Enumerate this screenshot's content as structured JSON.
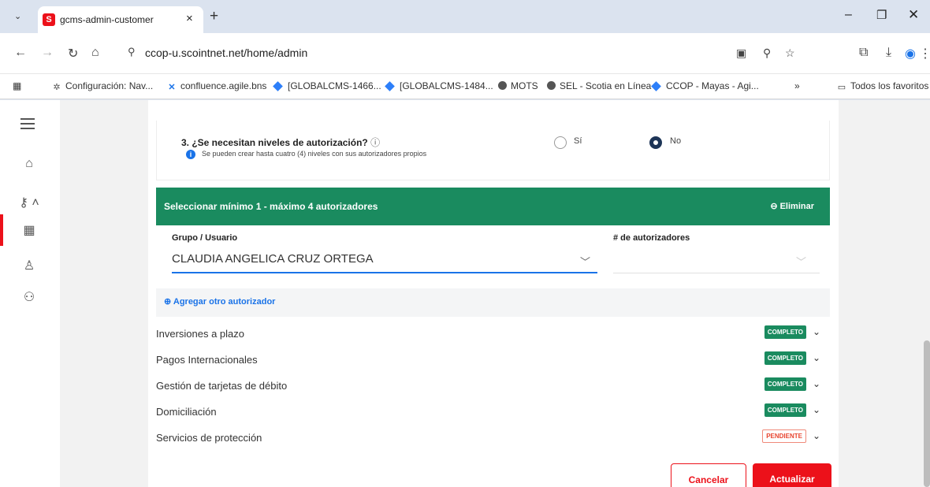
{
  "browser": {
    "tab_title": "gcms-admin-customer",
    "tab_favicon": "S",
    "url": "ccop-u.scointnet.net/home/admin",
    "bookmarks": [
      {
        "label": "Configuración: Nav...",
        "icon": "gear-icon"
      },
      {
        "label": "confluence.agile.bns",
        "icon": "confluence-icon"
      },
      {
        "label": "[GLOBALCMS-1466...",
        "icon": "jira-icon"
      },
      {
        "label": "[GLOBALCMS-1484...",
        "icon": "jira-icon"
      },
      {
        "label": "MOTS",
        "icon": "globe-icon"
      },
      {
        "label": "SEL - Scotia en Línea",
        "icon": "globe-icon"
      },
      {
        "label": "CCOP - Mayas - Agi...",
        "icon": "jira-icon"
      }
    ],
    "all_bookmarks": "Todos los favoritos"
  },
  "question": {
    "title": "3. ¿Se necesitan niveles de autorización?",
    "help": "Se pueden crear hasta cuatro (4) niveles con sus autorizadores propios",
    "options": [
      {
        "label": "Sí",
        "checked": false
      },
      {
        "label": "No",
        "checked": true
      }
    ]
  },
  "approvers": {
    "header": "Seleccionar mínimo 1 - máximo 4 autorizadores",
    "delete_label": "Eliminar",
    "group_label": "Grupo / Usuario",
    "group_value": "CLAUDIA ANGELICA CRUZ ORTEGA",
    "count_label": "# de autorizadores",
    "count_value": "",
    "add_label": "Agregar otro autorizador"
  },
  "sections": [
    {
      "label": "Inversiones a plazo",
      "status": "COMPLETO"
    },
    {
      "label": "Pagos Internacionales",
      "status": "COMPLETO"
    },
    {
      "label": "Gestión de tarjetas de débito",
      "status": "COMPLETO"
    },
    {
      "label": "Domiciliación",
      "status": "COMPLETO"
    },
    {
      "label": "Servicios de protección",
      "status": "PENDIENTE"
    }
  ],
  "actions": {
    "cancel": "Cancelar",
    "update": "Actualizar"
  },
  "colors": {
    "brand_red": "#ec111a",
    "success_green": "#1a8b5f",
    "link_blue": "#1a73e8"
  }
}
